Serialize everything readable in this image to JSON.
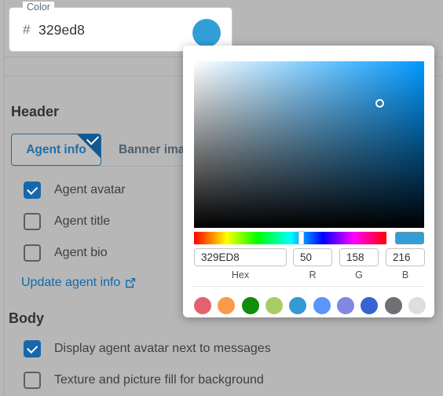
{
  "color_field": {
    "label": "Color",
    "hash": "#",
    "value": "329ed8",
    "swatch_color": "#329ed8"
  },
  "sections": {
    "header": {
      "title": "Header",
      "tabs": [
        {
          "label": "Agent info",
          "active": true,
          "badge_icon": "check-icon"
        },
        {
          "label": "Banner ima",
          "active": false
        }
      ],
      "checkboxes": [
        {
          "label": "Agent avatar",
          "checked": true
        },
        {
          "label": "Agent title",
          "checked": false
        },
        {
          "label": "Agent bio",
          "checked": false
        }
      ],
      "link": {
        "label": "Update agent info",
        "icon": "external-link-icon"
      }
    },
    "body": {
      "title": "Body",
      "checkboxes": [
        {
          "label": "Display agent avatar next to messages",
          "checked": true
        },
        {
          "label": "Texture and picture fill for background",
          "checked": false
        }
      ]
    }
  },
  "color_picker": {
    "hex": {
      "value": "329ED8",
      "caption": "Hex"
    },
    "r": {
      "value": "50",
      "caption": "R"
    },
    "g": {
      "value": "158",
      "caption": "G"
    },
    "b": {
      "value": "216",
      "caption": "B"
    },
    "preview_color": "#329ed8",
    "presets": [
      "#e4626f",
      "#fb9a4b",
      "#118c0b",
      "#a9cd65",
      "#3499d4",
      "#5b94fb",
      "#8287e2",
      "#3764d2",
      "#6e7073",
      "#dcdedf"
    ]
  },
  "theme": {
    "accent": "#1668ab",
    "link": "#1268ab",
    "page_bg": "#b7b7b7"
  }
}
